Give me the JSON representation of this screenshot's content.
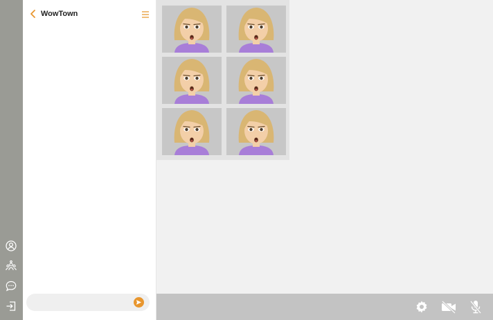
{
  "header": {
    "title": "WowTown"
  },
  "chat": {
    "input_value": "",
    "input_placeholder": ""
  },
  "video_grid": {
    "tiles": [
      {
        "avatar": "participant-avatar"
      },
      {
        "avatar": "participant-avatar"
      },
      {
        "avatar": "participant-avatar"
      },
      {
        "avatar": "participant-avatar"
      },
      {
        "avatar": "participant-avatar"
      },
      {
        "avatar": "participant-avatar"
      }
    ]
  },
  "rail": {
    "icons": [
      "profile-icon",
      "people-icon",
      "chat-icon",
      "exit-icon"
    ]
  },
  "toolbar": {
    "icons": [
      "settings-icon",
      "camera-off-icon",
      "mic-off-icon"
    ]
  },
  "colors": {
    "accent": "#e8962e",
    "rail": "#9a9b95",
    "toolbar": "#c3c3c3",
    "tile_bg": "#c7c7c7",
    "shirt": "#a87ed8",
    "hair": "#d9b673",
    "skin": "#f3cfa8"
  }
}
